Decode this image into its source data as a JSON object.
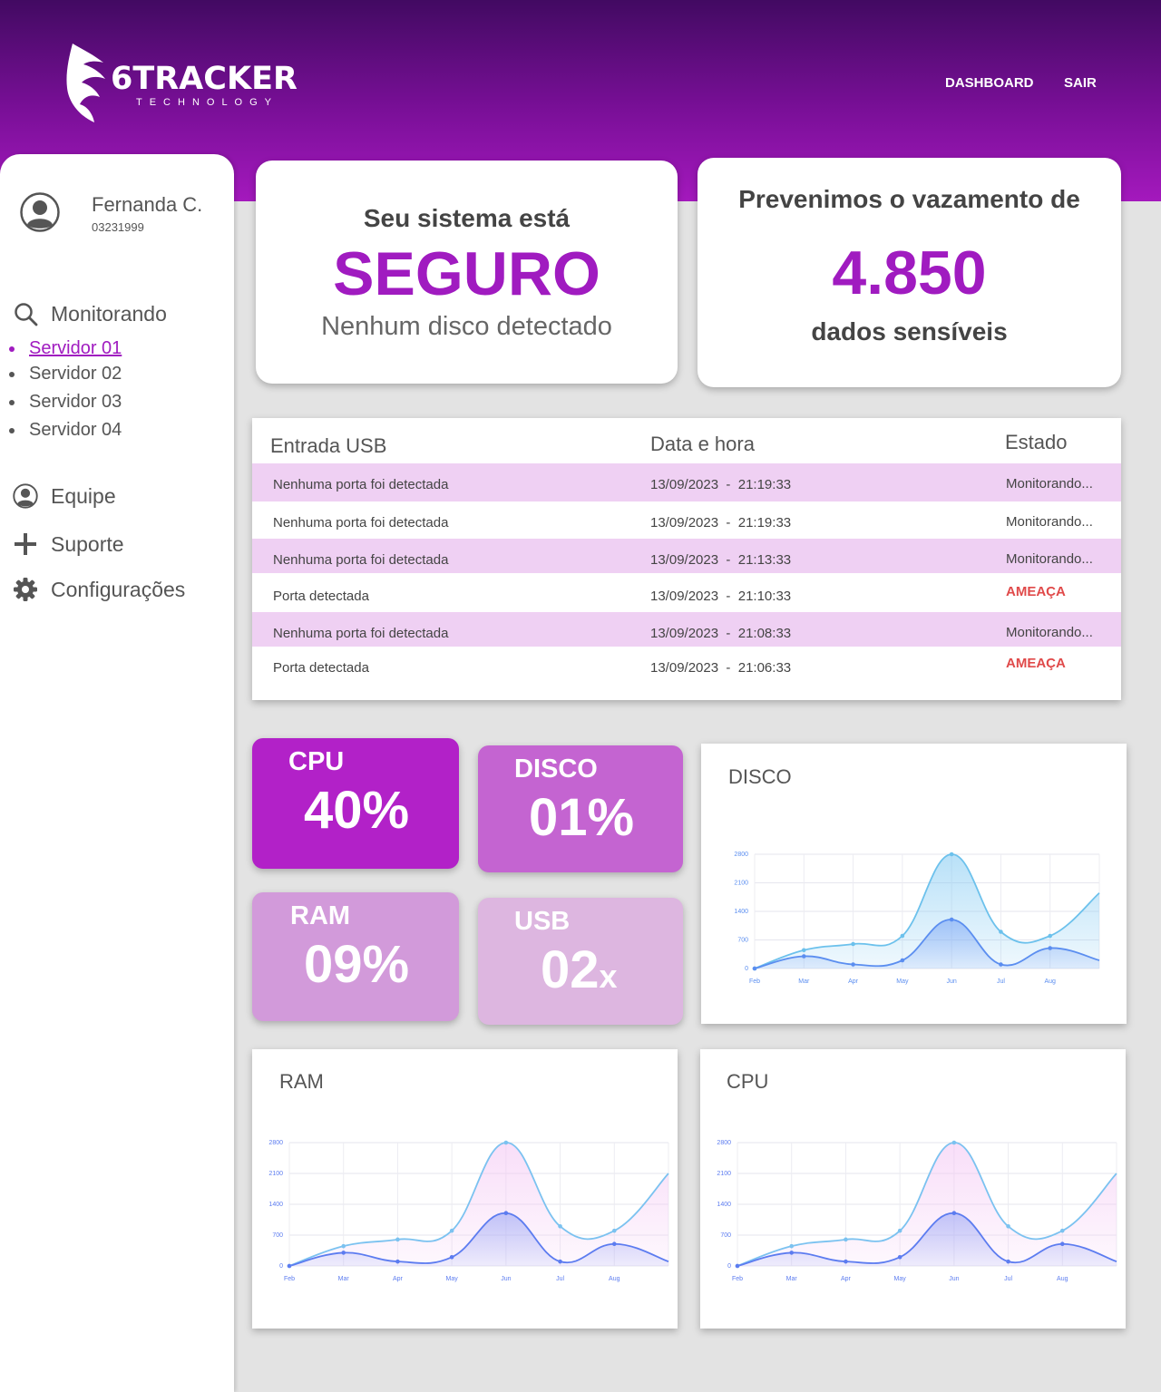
{
  "brand": {
    "name": "6TRACKER",
    "sub": "TECHNOLOGY"
  },
  "nav": {
    "dashboard": "DASHBOARD",
    "logout": "SAIR"
  },
  "user": {
    "name": "Fernanda C.",
    "id": "03231999"
  },
  "sidebar": {
    "monitoring": "Monitorando",
    "servers": [
      "Servidor 01",
      "Servidor 02",
      "Servidor 03",
      "Servidor 04"
    ],
    "team": "Equipe",
    "support": "Suporte",
    "settings": "Configurações"
  },
  "status_card": {
    "line1": "Seu sistema está",
    "status": "SEGURO",
    "detail": "Nenhum disco detectado"
  },
  "prevent_card": {
    "line1": "Prevenimos o vazamento de",
    "value": "4.850",
    "line2": "dados sensíveis"
  },
  "table": {
    "headers": [
      "Entrada USB",
      "Data e hora",
      "Estado"
    ],
    "rows": [
      {
        "entry": "Nenhuma porta foi detectada",
        "datetime": "13/09/2023  -  21:19:33",
        "state": "Monitorando...",
        "threat": false
      },
      {
        "entry": "Nenhuma porta foi detectada",
        "datetime": "13/09/2023  -  21:19:33",
        "state": "Monitorando...",
        "threat": false
      },
      {
        "entry": "Nenhuma porta foi detectada",
        "datetime": "13/09/2023  -  21:13:33",
        "state": "Monitorando...",
        "threat": false
      },
      {
        "entry": "Porta detectada",
        "datetime": "13/09/2023  -  21:10:33",
        "state": "AMEAÇA",
        "threat": true
      },
      {
        "entry": "Nenhuma porta foi detectada",
        "datetime": "13/09/2023  -  21:08:33",
        "state": "Monitorando...",
        "threat": false
      },
      {
        "entry": "Porta detectada",
        "datetime": "13/09/2023  -  21:06:33",
        "state": "AMEAÇA",
        "threat": true
      }
    ]
  },
  "metrics": {
    "cpu": {
      "label": "CPU",
      "value": "40%"
    },
    "disk": {
      "label": "DISCO",
      "value": "01%"
    },
    "ram": {
      "label": "RAM",
      "value": "09%"
    },
    "usb": {
      "label": "USB",
      "value": "02",
      "suffix": "x"
    }
  },
  "colors": {
    "accent": "#a01bc0",
    "threat": "#e04a4a",
    "row_highlight": "#efd0f3"
  },
  "chart_data": [
    {
      "type": "area",
      "title": "DISCO",
      "categories": [
        "Feb",
        "Mar",
        "Apr",
        "May",
        "Jun",
        "Jul",
        "Aug"
      ],
      "yticks": [
        0,
        700,
        1400,
        2100,
        2800
      ],
      "ylim": [
        0,
        2800
      ],
      "grid": true,
      "series": [
        {
          "x": [
            1,
            2,
            3,
            4,
            5,
            6,
            7,
            8
          ],
          "values": [
            0,
            450,
            600,
            800,
            2800,
            900,
            800,
            1850
          ]
        },
        {
          "x": [
            1,
            2,
            3,
            4,
            5,
            6,
            7,
            8
          ],
          "values": [
            0,
            300,
            100,
            200,
            1200,
            100,
            500,
            200
          ]
        }
      ]
    },
    {
      "type": "area",
      "title": "RAM",
      "categories": [
        "Feb",
        "Mar",
        "Apr",
        "May",
        "Jun",
        "Jul",
        "Aug"
      ],
      "yticks": [
        0,
        700,
        1400,
        2100,
        2800
      ],
      "ylim": [
        0,
        2800
      ],
      "grid": true,
      "series": [
        {
          "x": [
            1,
            2,
            3,
            4,
            5,
            6,
            7,
            8
          ],
          "values": [
            0,
            450,
            600,
            800,
            2800,
            900,
            800,
            2100
          ]
        },
        {
          "x": [
            1,
            2,
            3,
            4,
            5,
            6,
            7,
            8
          ],
          "values": [
            0,
            300,
            100,
            200,
            1200,
            100,
            500,
            100
          ]
        }
      ]
    },
    {
      "type": "area",
      "title": "CPU",
      "categories": [
        "Feb",
        "Mar",
        "Apr",
        "May",
        "Jun",
        "Jul",
        "Aug"
      ],
      "yticks": [
        0,
        700,
        1400,
        2100,
        2800
      ],
      "ylim": [
        0,
        2800
      ],
      "grid": true,
      "series": [
        {
          "x": [
            1,
            2,
            3,
            4,
            5,
            6,
            7,
            8
          ],
          "values": [
            0,
            450,
            600,
            800,
            2800,
            900,
            800,
            2100
          ]
        },
        {
          "x": [
            1,
            2,
            3,
            4,
            5,
            6,
            7,
            8
          ],
          "values": [
            0,
            300,
            100,
            200,
            1200,
            100,
            500,
            100
          ]
        }
      ]
    }
  ]
}
